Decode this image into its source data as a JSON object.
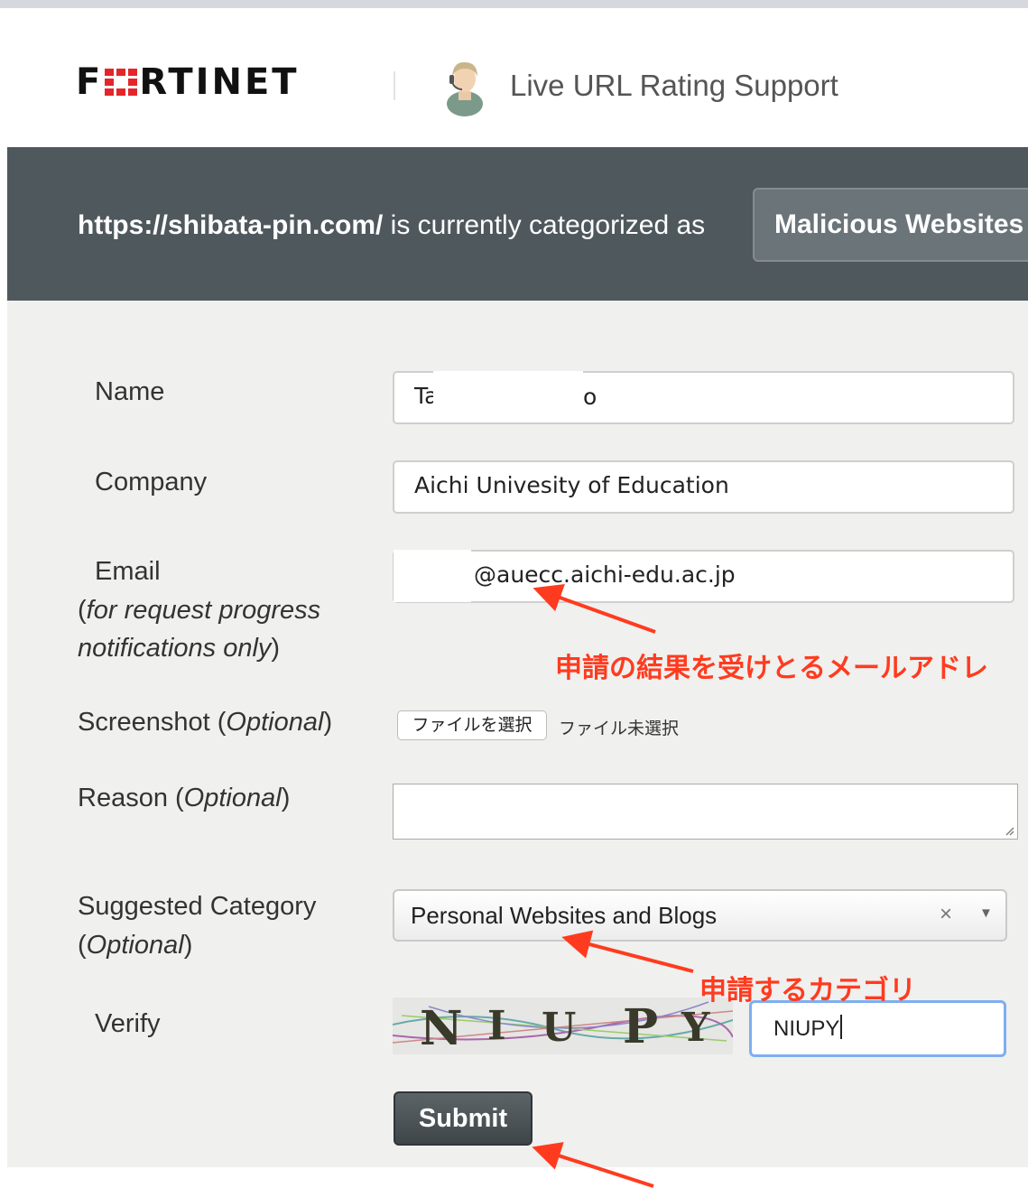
{
  "header": {
    "brand": "FORTINET",
    "title": "Live URL Rating Support"
  },
  "banner": {
    "url": "https://shibata-pin.com/",
    "text": " is currently categorized as",
    "category": "Malicious Websites"
  },
  "form": {
    "name_label": "Name",
    "name_value_start": "Ta",
    "name_value_end": "o",
    "company_label": "Company",
    "company_value": "Aichi Univesity of Education",
    "email_label": "Email",
    "email_note_open": "(",
    "email_note": "for request progress notifications only",
    "email_note_close": ")",
    "email_value": "@auecc.aichi-edu.ac.jp",
    "screenshot_label": "Screenshot (",
    "screenshot_optional": "Optional",
    "screenshot_close": ")",
    "file_button": "ファイルを選択",
    "file_status": "ファイル未選択",
    "reason_label": "Reason (",
    "reason_optional": "Optional",
    "reason_close": ")",
    "category_label": "Suggested Category",
    "category_optional_open": "(",
    "category_optional": "Optional",
    "category_optional_close": ")",
    "category_value": "Personal Websites and Blogs",
    "category_clear": "×",
    "category_arrow": "▼",
    "verify_label": "Verify",
    "captcha_text": [
      "N",
      "I",
      "U",
      "P",
      "Y"
    ],
    "verify_value": "NIUPY",
    "submit_label": "Submit"
  },
  "annotations": {
    "email_note": "申請の結果を受けとるメールアドレ",
    "category_note": "申請するカテゴリ"
  },
  "colors": {
    "banner": "#4f585d",
    "annotation": "#ff3b1f",
    "logo_accent": "#e4262b",
    "focus_border": "#7eaef0"
  }
}
